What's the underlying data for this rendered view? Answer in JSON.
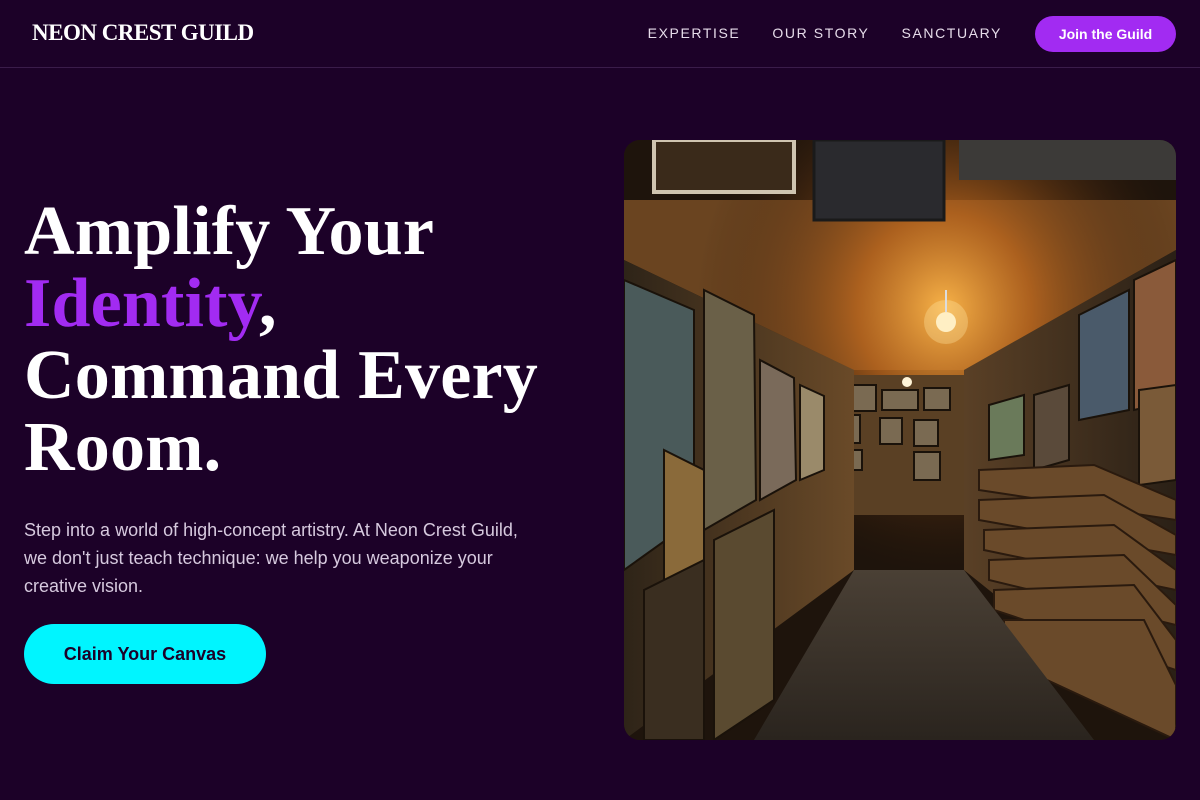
{
  "brand": {
    "name": "NEON CREST GUILD"
  },
  "nav": {
    "links": [
      {
        "label": "EXPERTISE"
      },
      {
        "label": "OUR STORY"
      },
      {
        "label": "SANCTUARY"
      }
    ],
    "cta_label": "Join the Guild"
  },
  "hero": {
    "headline": {
      "line1": "Amplify Your",
      "accent": "Identity",
      "comma": ",",
      "line3": "Command Every",
      "line4": "Room."
    },
    "description": "Step into a world of high-concept artistry. At Neon Crest Guild, we don't just teach technique: we help you weaponize your creative vision.",
    "cta_label": "Claim Your Canvas",
    "image": {
      "subject": "art-gallery-corridor-photo"
    }
  },
  "colors": {
    "background": "#1c0128",
    "accent_purple": "#a22bf2",
    "accent_cyan": "#00f5ff",
    "text_primary": "#ffffff",
    "text_muted": "#d6c9de"
  }
}
